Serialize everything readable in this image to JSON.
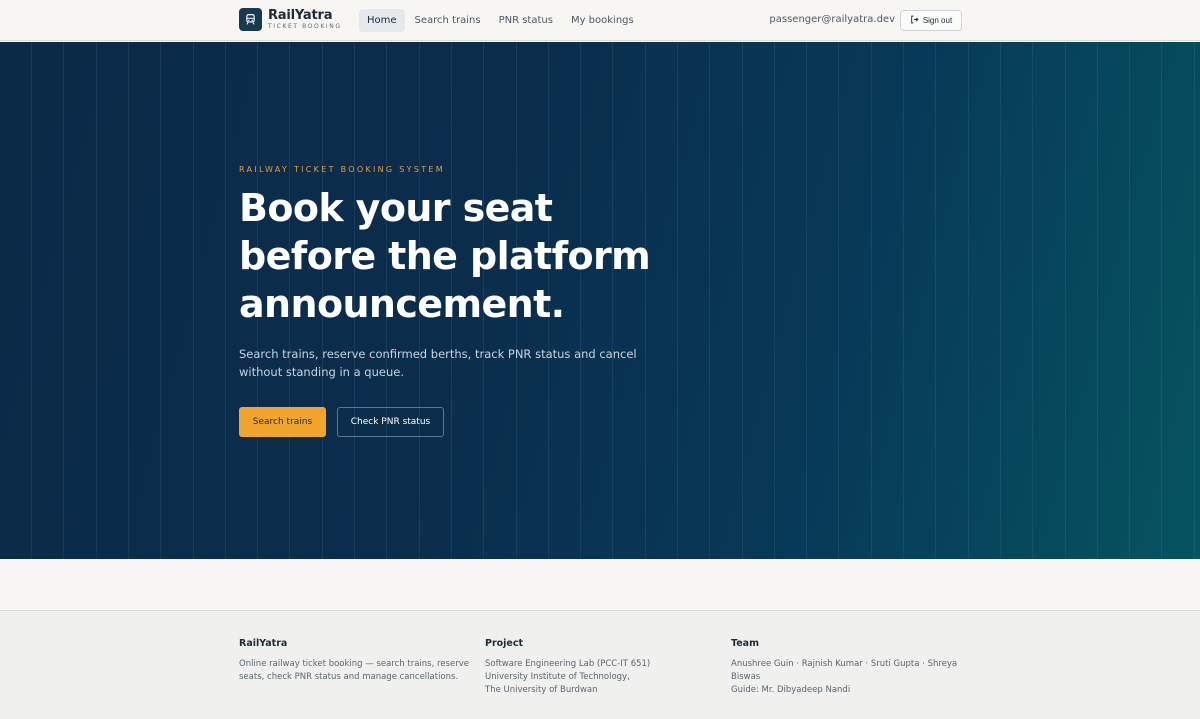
{
  "brand": {
    "name": "RailYatra",
    "tagline": "TICKET BOOKING"
  },
  "nav": [
    {
      "label": "Home",
      "active": true
    },
    {
      "label": "Search trains",
      "active": false
    },
    {
      "label": "PNR status",
      "active": false
    },
    {
      "label": "My bookings",
      "active": false
    }
  ],
  "user": {
    "email": "passenger@railyatra.dev",
    "signout_label": "Sign out"
  },
  "hero": {
    "eyebrow": "RAILWAY TICKET BOOKING SYSTEM",
    "headline": "Book your seat before the platform announcement.",
    "lead": "Search trains, reserve confirmed berths, track PNR status and cancel without standing in a queue.",
    "primary_cta": "Search trains",
    "secondary_cta": "Check PNR status"
  },
  "footer": {
    "about": {
      "title": "RailYatra",
      "text": "Online railway ticket booking — search trains, reserve seats, check PNR status and manage cancellations."
    },
    "project": {
      "title": "Project",
      "lines": [
        "Software Engineering Lab (PCC-IT 651)",
        "University Institute of Technology,",
        "The University of Burdwan"
      ]
    },
    "team": {
      "title": "Team",
      "lines": [
        "Anushree Guin · Rajnish Kumar · Sruti Gupta · Shreya Biswas",
        "Guide: Mr. Dibyadeep Nandi"
      ]
    }
  },
  "colors": {
    "accent": "#f2a52c",
    "hero_start": "#0b2a48",
    "hero_end": "#065460",
    "brand_mark": "#163a52"
  },
  "icons": {
    "logo": "train-icon",
    "signout": "sign-out-icon"
  }
}
